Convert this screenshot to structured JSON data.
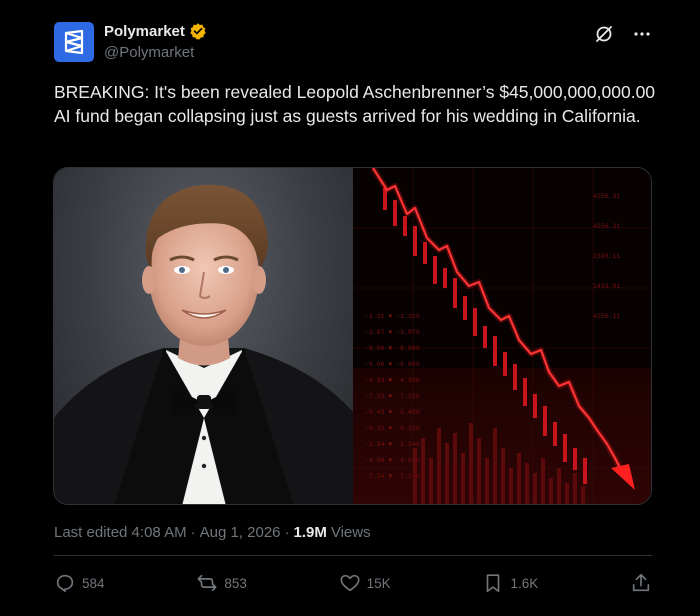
{
  "account": {
    "display_name": "Polymarket",
    "handle": "@Polymarket",
    "avatar_icon": "polymarket-logo",
    "verified_color": "#f4b400"
  },
  "tweet": {
    "text": "BREAKING: It's been revealed Leopold Aschenbrenner’s $45,000,000,000.00 AI fund began collapsing just as guests arrived for his wedding in California."
  },
  "media": {
    "left_image": "portrait-man-in-tuxedo",
    "right_image": "red-crashing-stock-chart"
  },
  "meta": {
    "edited": "Last edited 4:08 AM",
    "separator1": "·",
    "date": "Aug 1, 2026",
    "separator2": "·",
    "views_count": "1.9M",
    "views_label": "Views"
  },
  "actions": {
    "replies": "584",
    "reposts": "853",
    "likes": "15K",
    "bookmarks": "1.6K"
  },
  "colors": {
    "background": "#000000",
    "text": "#e7e9ea",
    "muted": "#71767b",
    "brand": "#2d6ae3",
    "chart_red": "#e0141b"
  }
}
